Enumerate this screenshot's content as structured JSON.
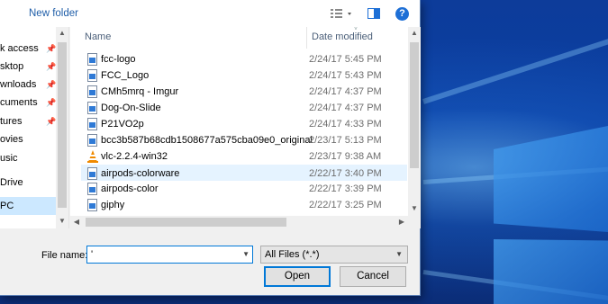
{
  "toolbar": {
    "new_folder_label": "New folder",
    "view_icon": "view-details-icon",
    "pane_icon": "preview-pane-icon",
    "help_icon": "help-icon",
    "help_label": "?"
  },
  "nav": {
    "items": [
      {
        "label": "k access",
        "pinned": true
      },
      {
        "label": "sktop",
        "pinned": true
      },
      {
        "label": "wnloads",
        "pinned": true
      },
      {
        "label": "cuments",
        "pinned": true
      },
      {
        "label": "tures",
        "pinned": true
      },
      {
        "label": "ovies",
        "pinned": false
      },
      {
        "label": "usic",
        "pinned": false
      },
      {
        "label": "Drive",
        "pinned": false
      },
      {
        "label": "PC",
        "pinned": false,
        "selected": true
      }
    ],
    "pin_glyph": "📌"
  },
  "columns": {
    "name": "Name",
    "date_modified": "Date modified"
  },
  "files": [
    {
      "name": "fcc-logo",
      "date": "2/24/17 5:45 PM",
      "icon": "image-file-icon"
    },
    {
      "name": "FCC_Logo",
      "date": "2/24/17 5:43 PM",
      "icon": "image-file-icon"
    },
    {
      "name": "CMh5mrq - Imgur",
      "date": "2/24/17 4:37 PM",
      "icon": "image-file-icon"
    },
    {
      "name": "Dog-On-Slide",
      "date": "2/24/17 4:37 PM",
      "icon": "image-file-icon"
    },
    {
      "name": "P21VO2p",
      "date": "2/24/17 4:33 PM",
      "icon": "image-file-icon"
    },
    {
      "name": "bcc3b587b68cdb1508677a575cba09e0_original",
      "date": "2/23/17 5:13 PM",
      "icon": "image-file-icon"
    },
    {
      "name": "vlc-2.2.4-win32",
      "date": "2/23/17 9:38 AM",
      "icon": "vlc-cone-icon"
    },
    {
      "name": "airpods-colorware",
      "date": "2/22/17 3:40 PM",
      "icon": "image-file-icon",
      "selected": true
    },
    {
      "name": "airpods-color",
      "date": "2/22/17 3:39 PM",
      "icon": "image-file-icon"
    },
    {
      "name": "giphy",
      "date": "2/22/17 3:25 PM",
      "icon": "image-file-icon"
    }
  ],
  "bottom": {
    "file_name_label": "File name:",
    "file_name_value": "'",
    "filter_value": "All Files (*.*)",
    "open_label": "Open",
    "cancel_label": "Cancel"
  },
  "colors": {
    "accent": "#0078d7",
    "selection": "#e5f3ff",
    "nav_selection": "#cce8ff",
    "link": "#1e5da8"
  }
}
